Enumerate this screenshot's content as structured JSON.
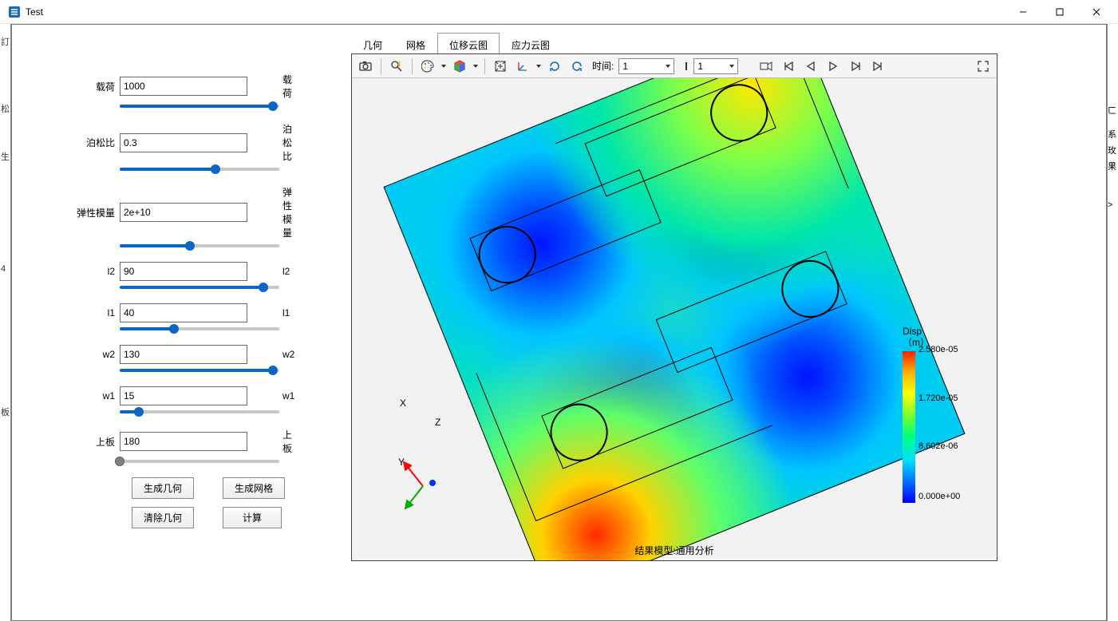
{
  "window": {
    "title": "Test"
  },
  "parameters": [
    {
      "label_left": "载荷",
      "value": "1000",
      "label_right": "载荷",
      "slider_pct": 96
    },
    {
      "label_left": "泊松比",
      "value": "0.3",
      "label_right": "泊松比",
      "slider_pct": 60
    },
    {
      "label_left": "弹性模量",
      "value": "2e+10",
      "label_right": "弹性模量",
      "slider_pct": 44
    },
    {
      "label_left": "l2",
      "value": "90",
      "label_right": "l2",
      "slider_pct": 90
    },
    {
      "label_left": "l1",
      "value": "40",
      "label_right": "l1",
      "slider_pct": 34
    },
    {
      "label_left": "w2",
      "value": "130",
      "label_right": "w2",
      "slider_pct": 96
    },
    {
      "label_left": "w1",
      "value": "15",
      "label_right": "w1",
      "slider_pct": 12
    },
    {
      "label_left": "上板",
      "value": "180",
      "label_right": "上板",
      "slider_pct": 0,
      "gray": true
    }
  ],
  "buttons": {
    "generate_geom": "生成几何",
    "generate_mesh": "生成网格",
    "clear_geom": "清除几何",
    "compute": "计算"
  },
  "tabs": [
    {
      "label": "几何",
      "active": false
    },
    {
      "label": "网格",
      "active": false
    },
    {
      "label": "位移云图",
      "active": true
    },
    {
      "label": "应力云图",
      "active": false
    }
  ],
  "toolbar": {
    "time_label": "时间:",
    "time_select1": "1",
    "time_select2": "1"
  },
  "legend": {
    "title1": "Disp",
    "title2": "（m）",
    "ticks": [
      "2.580e-05",
      "1.720e-05",
      "8.602e-06",
      "0.000e+00"
    ]
  },
  "triad": {
    "x": "X",
    "y": "Y",
    "z": "Z"
  },
  "result_label": "结果模型:通用分析",
  "chart_data": {
    "type": "heatmap",
    "title": "Disp (m)",
    "colormap": "rainbow",
    "value_range": [
      0.0,
      2.58e-05
    ],
    "legend_ticks": [
      0.0,
      8.602e-06,
      1.72e-05,
      2.58e-05
    ],
    "axes": {
      "x": "X",
      "y": "Y",
      "z": "Z"
    },
    "description": "Displacement contour on rotated square plate with four slot+hole features; blue minima at four holes, red maximum near lower-left edge, yellow peak near upper-right corner."
  }
}
